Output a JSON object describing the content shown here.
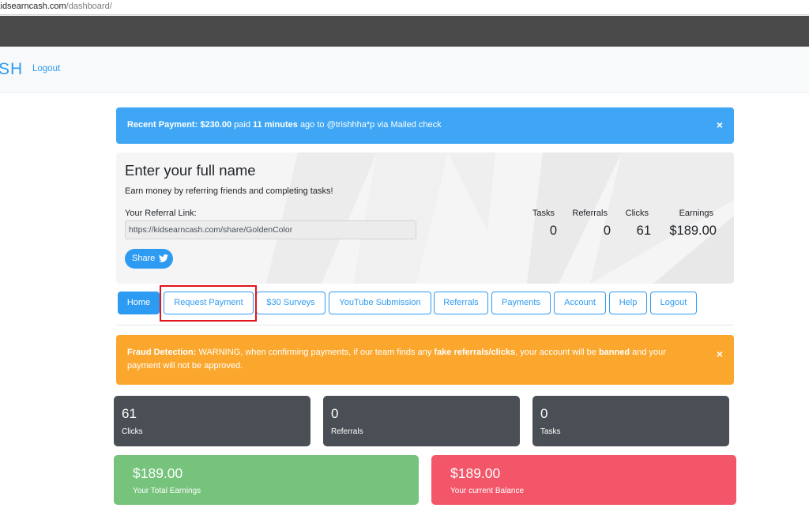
{
  "browser": {
    "url_domain": "kidsearncash.com",
    "url_path": "/dashboard/"
  },
  "navbar": {
    "brand": "SH",
    "logout_label": "Logout"
  },
  "recent_payment": {
    "label": "Recent Payment:",
    "amount": "$230.00",
    "text_paid": "paid",
    "time": "11 minutes",
    "text_ago": "ago to @trishhha*p via Mailed check",
    "close": "×"
  },
  "jumbotron": {
    "title": "Enter your full name",
    "subtitle": "Earn money by referring friends and completing tasks!",
    "referral_label": "Your Referral Link:",
    "referral_link": "https://kidsearncash.com/share/GoldenColor",
    "share_label": "Share",
    "stats": {
      "tasks_label": "Tasks",
      "tasks_value": "0",
      "referrals_label": "Referrals",
      "referrals_value": "0",
      "clicks_label": "Clicks",
      "clicks_value": "61",
      "earnings_label": "Earnings",
      "earnings_value": "$189.00"
    }
  },
  "tabs": {
    "home": "Home",
    "request_payment": "Request Payment",
    "surveys": "$30 Surveys",
    "youtube": "YouTube Submission",
    "referrals": "Referrals",
    "payments": "Payments",
    "account": "Account",
    "help": "Help",
    "logout": "Logout"
  },
  "fraud_alert": {
    "label": "Fraud Detection:",
    "text1": "WARNING, when confirming payments, if our team finds any",
    "bold1": "fake referrals/clicks",
    "text2": ", your account will be",
    "bold2": "banned",
    "text3": "and your payment will not be approved.",
    "close": "×"
  },
  "cards": {
    "clicks_value": "61",
    "clicks_label": "Clicks",
    "referrals_value": "0",
    "referrals_label": "Referrals",
    "tasks_value": "0",
    "tasks_label": "Tasks",
    "total_earnings_value": "$189.00",
    "total_earnings_label": "Your Total Earnings",
    "balance_value": "$189.00",
    "balance_label": "Your current Balance"
  },
  "colors": {
    "primary": "#2e9bf2",
    "info": "#3ea6f4",
    "warning": "#fba72d",
    "dark": "#4a4f55",
    "success": "#76c37c",
    "danger": "#f25668",
    "highlight": "#e2131b"
  }
}
